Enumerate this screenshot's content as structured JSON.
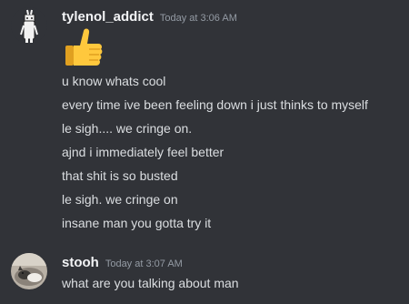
{
  "messages": [
    {
      "username": "tylenol_addict",
      "timestamp": "Today at 3:06 AM",
      "avatar_icon": "person-figure-avatar",
      "emoji": "thumbs-up-icon",
      "lines": [
        "u know whats cool",
        "every time ive been feeling down i just thinks to myself",
        "le sigh.... we cringe on.",
        "ajnd i immediately feel better",
        "that shit is so busted",
        "le sigh. we cringe on",
        "insane man you gotta try it"
      ]
    },
    {
      "username": "stooh",
      "timestamp": "Today at 3:07 AM",
      "avatar_icon": "cat-photo-avatar",
      "lines": [
        "what are you  talking about man"
      ]
    }
  ],
  "colors": {
    "background": "#313338",
    "username": "#f2f3f5",
    "text": "#dbdee1",
    "timestamp": "#949ba4",
    "thumb": "#ffc83d"
  }
}
